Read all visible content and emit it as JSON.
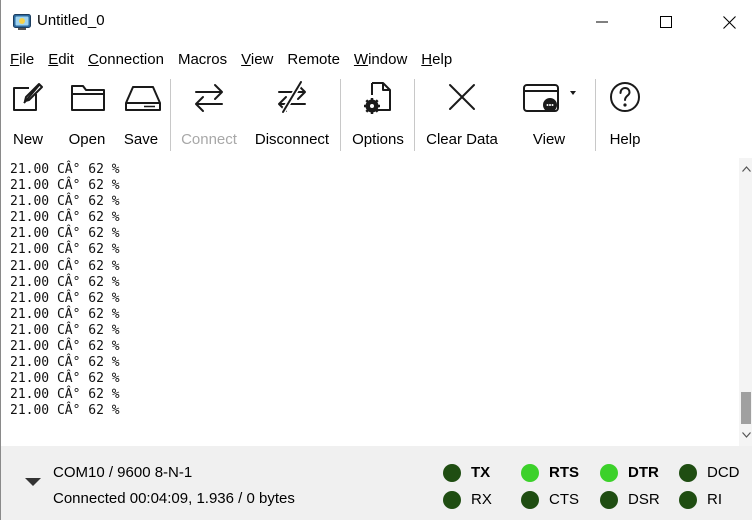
{
  "window": {
    "title": "Untitled_0"
  },
  "menu": [
    {
      "label": "File",
      "accel_index": 0
    },
    {
      "label": "Edit",
      "accel_index": 0
    },
    {
      "label": "Connection",
      "accel_index": 0
    },
    {
      "label": "Macros",
      "accel_index": -1
    },
    {
      "label": "View",
      "accel_index": 0
    },
    {
      "label": "Remote",
      "accel_index": -1
    },
    {
      "label": "Window",
      "accel_index": 0
    },
    {
      "label": "Help",
      "accel_index": 0
    }
  ],
  "toolbar": {
    "new": "New",
    "open": "Open",
    "save": "Save",
    "connect": "Connect",
    "disconnect": "Disconnect",
    "options": "Options",
    "clear": "Clear Data",
    "view": "View",
    "help": "Help"
  },
  "terminal": {
    "lines": [
      "21.00 CÂ° 62 %",
      "21.00 CÂ° 62 %",
      "21.00 CÂ° 62 %",
      "21.00 CÂ° 62 %",
      "21.00 CÂ° 62 %",
      "21.00 CÂ° 62 %",
      "21.00 CÂ° 62 %",
      "21.00 CÂ° 62 %",
      "21.00 CÂ° 62 %",
      "21.00 CÂ° 62 %",
      "21.00 CÂ° 62 %",
      "21.00 CÂ° 62 %",
      "21.00 CÂ° 62 %",
      "21.00 CÂ° 62 %",
      "21.00 CÂ° 62 %",
      "21.00 CÂ° 62 %"
    ]
  },
  "status": {
    "port": "COM10 / 9600 8-N-1",
    "connection": "Connected 00:04:09, 1.936 / 0 bytes"
  },
  "signals": {
    "tx": {
      "label": "TX",
      "active": false,
      "bold": true
    },
    "rx": {
      "label": "RX",
      "active": false,
      "bold": false
    },
    "rts": {
      "label": "RTS",
      "active": true,
      "bold": true
    },
    "cts": {
      "label": "CTS",
      "active": false,
      "bold": false
    },
    "dtr": {
      "label": "DTR",
      "active": true,
      "bold": true
    },
    "dsr": {
      "label": "DSR",
      "active": false,
      "bold": false
    },
    "dcd": {
      "label": "DCD",
      "active": false,
      "bold": false
    },
    "ri": {
      "label": "RI",
      "active": false,
      "bold": false
    }
  },
  "colors": {
    "led_on": "#3cd12a",
    "led_off": "#1f4d12",
    "statusbar": "#f0f0f0",
    "disabled_text": "#a8a8a8"
  },
  "icons": {
    "app": "app-terminal-icon",
    "new": "new-document-icon",
    "open": "folder-icon",
    "save": "drive-icon",
    "connect": "connect-arrows-icon",
    "disconnect": "disconnect-arrows-icon",
    "options": "settings-document-icon",
    "clear": "clear-x-icon",
    "view": "view-window-icon",
    "help": "help-question-icon"
  }
}
